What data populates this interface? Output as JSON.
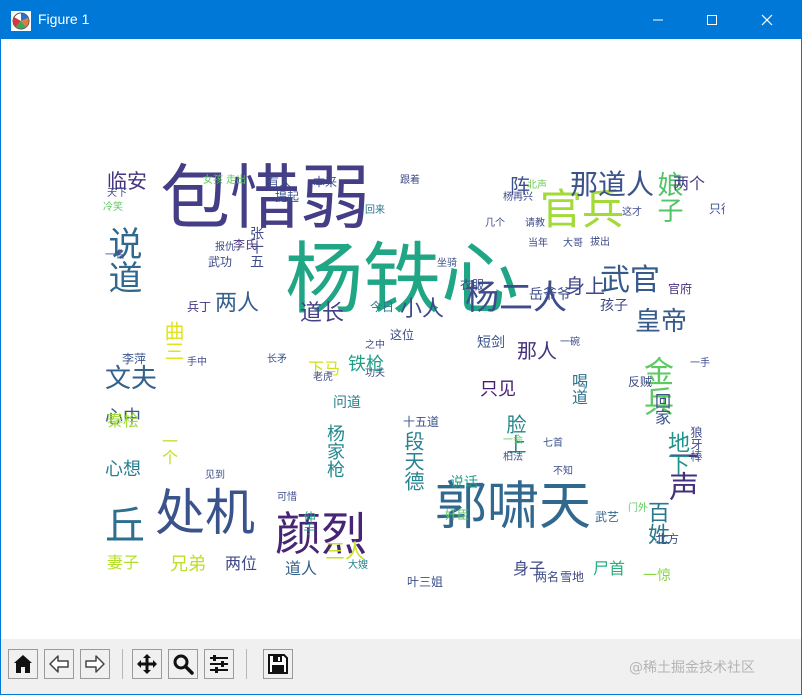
{
  "window": {
    "title": "Figure 1",
    "accent_color": "#0078d7",
    "icons": [
      "matplotlib-app-icon",
      "minimize-icon",
      "maximize-icon",
      "close-icon"
    ]
  },
  "wordcloud": {
    "colormap": "viridis",
    "words": [
      {
        "text": "杨铁心",
        "color": "#21a685"
      },
      {
        "text": "包惜弱",
        "color": "#433e85"
      },
      {
        "text": "郭啸天",
        "color": "#31688e"
      },
      {
        "text": "处机",
        "color": "#3a538b"
      },
      {
        "text": "颜烈",
        "color": "#482475"
      },
      {
        "text": "官兵",
        "color": "#a2da37"
      },
      {
        "text": "说道",
        "color": "#31688e"
      },
      {
        "text": "丘",
        "color": "#2e6f8e"
      },
      {
        "text": "杨二人",
        "color": "#3e4c8a"
      },
      {
        "text": "那道人",
        "color": "#3b528b"
      },
      {
        "text": "娘子",
        "color": "#52c569"
      },
      {
        "text": "武官",
        "color": "#375a8c"
      },
      {
        "text": "金兵",
        "color": "#5ec962"
      },
      {
        "text": "一声",
        "color": "#46307e"
      },
      {
        "text": "百姓",
        "color": "#2a788e"
      },
      {
        "text": "皇帝",
        "color": "#375b8d"
      },
      {
        "text": "文夫",
        "color": "#33628d"
      },
      {
        "text": "两人",
        "color": "#35608d"
      },
      {
        "text": "道长",
        "color": "#424086"
      },
      {
        "text": "小人",
        "color": "#3e4989"
      },
      {
        "text": "身上",
        "color": "#3f4788"
      },
      {
        "text": "临安",
        "color": "#46337f"
      },
      {
        "text": "阵",
        "color": "#3d4e8a"
      },
      {
        "text": "两个",
        "color": "#443a83"
      },
      {
        "text": "心中",
        "color": "#38598c"
      },
      {
        "text": "心想",
        "color": "#277f8e"
      },
      {
        "text": "地下",
        "color": "#1f948c"
      },
      {
        "text": "脸上",
        "color": "#25858e"
      },
      {
        "text": "段天德",
        "color": "#26828e"
      },
      {
        "text": "三人",
        "color": "#cae11f"
      },
      {
        "text": "兄弟",
        "color": "#bddf26"
      },
      {
        "text": "两位",
        "color": "#3f4889"
      },
      {
        "text": "道人",
        "color": "#33638d"
      },
      {
        "text": "妻子",
        "color": "#b5de2b"
      },
      {
        "text": "杨家枪",
        "color": "#24878e"
      },
      {
        "text": "那人",
        "color": "#46327e"
      },
      {
        "text": "只见",
        "color": "#481f70"
      },
      {
        "text": "喝道",
        "color": "#2c728e"
      },
      {
        "text": "回家",
        "color": "#3b518b"
      },
      {
        "text": "身子",
        "color": "#3e4a89"
      },
      {
        "text": "秦桧",
        "color": "#a0da39"
      },
      {
        "text": "曲三",
        "color": "#e1e41c"
      },
      {
        "text": "下马",
        "color": "#cde11d"
      },
      {
        "text": "铁枪",
        "color": "#1f9f88"
      },
      {
        "text": "短剑",
        "color": "#3b518b"
      },
      {
        "text": "孩子",
        "color": "#3f4788"
      },
      {
        "text": "问道",
        "color": "#27808e"
      },
      {
        "text": "十五道",
        "color": "#3b528b"
      },
      {
        "text": "一个",
        "color": "#bfdf25"
      },
      {
        "text": "说话",
        "color": "#1fa088"
      },
      {
        "text": "尸首",
        "color": "#2ab07f"
      },
      {
        "text": "北方",
        "color": "#3e4c8a"
      },
      {
        "text": "武艺",
        "color": "#31688e"
      },
      {
        "text": "岳爷爷",
        "color": "#3d4d8a"
      },
      {
        "text": "李萍",
        "color": "#3a548c"
      },
      {
        "text": "兵丁",
        "color": "#46327e"
      },
      {
        "text": "这位",
        "color": "#3c4f8a"
      },
      {
        "text": "今日",
        "color": "#2a778e"
      },
      {
        "text": "一惊",
        "color": "#89d548"
      },
      {
        "text": "雪地",
        "color": "#3f4788"
      },
      {
        "text": "两名",
        "color": "#3d4e8a"
      },
      {
        "text": "叶三姐",
        "color": "#3c4f8a"
      },
      {
        "text": "大嫂",
        "color": "#26818e"
      },
      {
        "text": "有人",
        "color": "#3b528b"
      },
      {
        "text": "本来",
        "color": "#3e4989"
      },
      {
        "text": "张十五",
        "color": "#3e4c8a"
      },
      {
        "text": "李氏",
        "color": "#46327e"
      },
      {
        "text": "武功",
        "color": "#3e4c8a"
      },
      {
        "text": "衣服",
        "color": "#3e4c8a"
      },
      {
        "text": "官府",
        "color": "#46327e"
      },
      {
        "text": "只得",
        "color": "#3a548c"
      },
      {
        "text": "女孩 走出",
        "color": "#5ec962"
      },
      {
        "text": "跟着",
        "color": "#3e4c8a"
      },
      {
        "text": "北声",
        "color": "#6ece58"
      },
      {
        "text": "回来",
        "color": "#2a788e"
      },
      {
        "text": "坐骑",
        "color": "#3b528b"
      },
      {
        "text": "提起",
        "color": "#3b528b"
      },
      {
        "text": "长矛",
        "color": "#3b528b"
      },
      {
        "text": "功夫",
        "color": "#3e4c8a"
      },
      {
        "text": "老虎",
        "color": "#3e4c8a"
      },
      {
        "text": "之中",
        "color": "#3e4c8a"
      },
      {
        "text": "一会",
        "color": "#5ec962"
      },
      {
        "text": "七首",
        "color": "#3b528b"
      },
      {
        "text": "桕法",
        "color": "#3b528b"
      },
      {
        "text": "一碗",
        "color": "#3e4c8a"
      },
      {
        "text": "反贼",
        "color": "#3e4c8a"
      },
      {
        "text": "一手",
        "color": "#3e4c8a"
      },
      {
        "text": "拔出",
        "color": "#3e4c8a"
      },
      {
        "text": "几个",
        "color": "#3e4c8a"
      },
      {
        "text": "当年",
        "color": "#3e4c8a"
      },
      {
        "text": "大哥",
        "color": "#3e4c8a"
      },
      {
        "text": "杨再兴",
        "color": "#3e4c8a"
      },
      {
        "text": "这才",
        "color": "#3e4c8a"
      },
      {
        "text": "请教",
        "color": "#3e4c8a"
      },
      {
        "text": "手中",
        "color": "#3e4c8a"
      },
      {
        "text": "可惜",
        "color": "#3e4c8a"
      },
      {
        "text": "见到",
        "color": "#3e4c8a"
      },
      {
        "text": "不知",
        "color": "#3e4c8a"
      },
      {
        "text": "伸手",
        "color": "#1fa088"
      },
      {
        "text": "门外",
        "color": "#5ec962"
      },
      {
        "text": "奸臣",
        "color": "#5ec962"
      },
      {
        "text": "狼牙棒",
        "color": "#3e4c8a"
      },
      {
        "text": "冷笑",
        "color": "#5ec962"
      },
      {
        "text": "天下",
        "color": "#3e4c8a"
      },
      {
        "text": "报仇",
        "color": "#3e4c8a"
      },
      {
        "text": "一名",
        "color": "#3e4c8a"
      }
    ]
  },
  "toolbar": {
    "buttons": [
      {
        "name": "home-button",
        "icon": "home-icon"
      },
      {
        "name": "back-button",
        "icon": "arrow-left-icon"
      },
      {
        "name": "forward-button",
        "icon": "arrow-right-icon"
      },
      {
        "name": "pan-button",
        "icon": "move-icon"
      },
      {
        "name": "zoom-button",
        "icon": "magnifier-icon"
      },
      {
        "name": "configure-subplots-button",
        "icon": "sliders-icon"
      },
      {
        "name": "save-button",
        "icon": "floppy-disk-icon"
      }
    ],
    "watermark": "@稀土掘金技术社区"
  }
}
